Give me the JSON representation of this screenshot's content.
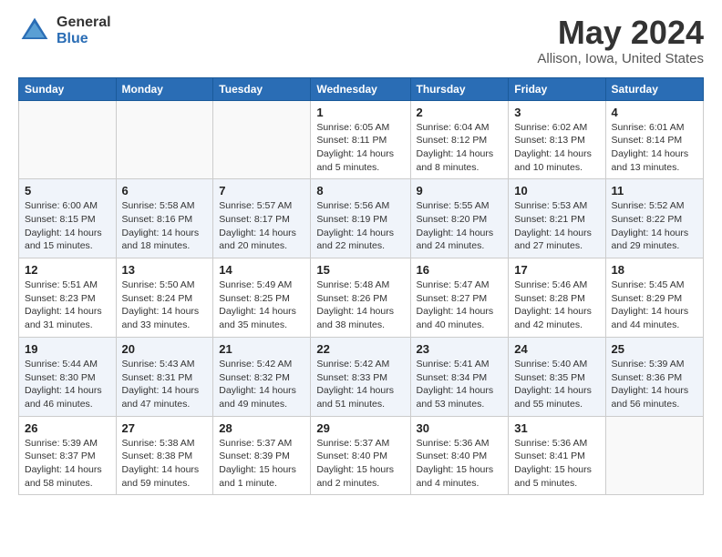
{
  "header": {
    "logo_general": "General",
    "logo_blue": "Blue",
    "title": "May 2024",
    "subtitle": "Allison, Iowa, United States"
  },
  "days_of_week": [
    "Sunday",
    "Monday",
    "Tuesday",
    "Wednesday",
    "Thursday",
    "Friday",
    "Saturday"
  ],
  "weeks": [
    [
      {
        "day": "",
        "info": ""
      },
      {
        "day": "",
        "info": ""
      },
      {
        "day": "",
        "info": ""
      },
      {
        "day": "1",
        "info": "Sunrise: 6:05 AM\nSunset: 8:11 PM\nDaylight: 14 hours\nand 5 minutes."
      },
      {
        "day": "2",
        "info": "Sunrise: 6:04 AM\nSunset: 8:12 PM\nDaylight: 14 hours\nand 8 minutes."
      },
      {
        "day": "3",
        "info": "Sunrise: 6:02 AM\nSunset: 8:13 PM\nDaylight: 14 hours\nand 10 minutes."
      },
      {
        "day": "4",
        "info": "Sunrise: 6:01 AM\nSunset: 8:14 PM\nDaylight: 14 hours\nand 13 minutes."
      }
    ],
    [
      {
        "day": "5",
        "info": "Sunrise: 6:00 AM\nSunset: 8:15 PM\nDaylight: 14 hours\nand 15 minutes."
      },
      {
        "day": "6",
        "info": "Sunrise: 5:58 AM\nSunset: 8:16 PM\nDaylight: 14 hours\nand 18 minutes."
      },
      {
        "day": "7",
        "info": "Sunrise: 5:57 AM\nSunset: 8:17 PM\nDaylight: 14 hours\nand 20 minutes."
      },
      {
        "day": "8",
        "info": "Sunrise: 5:56 AM\nSunset: 8:19 PM\nDaylight: 14 hours\nand 22 minutes."
      },
      {
        "day": "9",
        "info": "Sunrise: 5:55 AM\nSunset: 8:20 PM\nDaylight: 14 hours\nand 24 minutes."
      },
      {
        "day": "10",
        "info": "Sunrise: 5:53 AM\nSunset: 8:21 PM\nDaylight: 14 hours\nand 27 minutes."
      },
      {
        "day": "11",
        "info": "Sunrise: 5:52 AM\nSunset: 8:22 PM\nDaylight: 14 hours\nand 29 minutes."
      }
    ],
    [
      {
        "day": "12",
        "info": "Sunrise: 5:51 AM\nSunset: 8:23 PM\nDaylight: 14 hours\nand 31 minutes."
      },
      {
        "day": "13",
        "info": "Sunrise: 5:50 AM\nSunset: 8:24 PM\nDaylight: 14 hours\nand 33 minutes."
      },
      {
        "day": "14",
        "info": "Sunrise: 5:49 AM\nSunset: 8:25 PM\nDaylight: 14 hours\nand 35 minutes."
      },
      {
        "day": "15",
        "info": "Sunrise: 5:48 AM\nSunset: 8:26 PM\nDaylight: 14 hours\nand 38 minutes."
      },
      {
        "day": "16",
        "info": "Sunrise: 5:47 AM\nSunset: 8:27 PM\nDaylight: 14 hours\nand 40 minutes."
      },
      {
        "day": "17",
        "info": "Sunrise: 5:46 AM\nSunset: 8:28 PM\nDaylight: 14 hours\nand 42 minutes."
      },
      {
        "day": "18",
        "info": "Sunrise: 5:45 AM\nSunset: 8:29 PM\nDaylight: 14 hours\nand 44 minutes."
      }
    ],
    [
      {
        "day": "19",
        "info": "Sunrise: 5:44 AM\nSunset: 8:30 PM\nDaylight: 14 hours\nand 46 minutes."
      },
      {
        "day": "20",
        "info": "Sunrise: 5:43 AM\nSunset: 8:31 PM\nDaylight: 14 hours\nand 47 minutes."
      },
      {
        "day": "21",
        "info": "Sunrise: 5:42 AM\nSunset: 8:32 PM\nDaylight: 14 hours\nand 49 minutes."
      },
      {
        "day": "22",
        "info": "Sunrise: 5:42 AM\nSunset: 8:33 PM\nDaylight: 14 hours\nand 51 minutes."
      },
      {
        "day": "23",
        "info": "Sunrise: 5:41 AM\nSunset: 8:34 PM\nDaylight: 14 hours\nand 53 minutes."
      },
      {
        "day": "24",
        "info": "Sunrise: 5:40 AM\nSunset: 8:35 PM\nDaylight: 14 hours\nand 55 minutes."
      },
      {
        "day": "25",
        "info": "Sunrise: 5:39 AM\nSunset: 8:36 PM\nDaylight: 14 hours\nand 56 minutes."
      }
    ],
    [
      {
        "day": "26",
        "info": "Sunrise: 5:39 AM\nSunset: 8:37 PM\nDaylight: 14 hours\nand 58 minutes."
      },
      {
        "day": "27",
        "info": "Sunrise: 5:38 AM\nSunset: 8:38 PM\nDaylight: 14 hours\nand 59 minutes."
      },
      {
        "day": "28",
        "info": "Sunrise: 5:37 AM\nSunset: 8:39 PM\nDaylight: 15 hours\nand 1 minute."
      },
      {
        "day": "29",
        "info": "Sunrise: 5:37 AM\nSunset: 8:40 PM\nDaylight: 15 hours\nand 2 minutes."
      },
      {
        "day": "30",
        "info": "Sunrise: 5:36 AM\nSunset: 8:40 PM\nDaylight: 15 hours\nand 4 minutes."
      },
      {
        "day": "31",
        "info": "Sunrise: 5:36 AM\nSunset: 8:41 PM\nDaylight: 15 hours\nand 5 minutes."
      },
      {
        "day": "",
        "info": ""
      }
    ]
  ]
}
